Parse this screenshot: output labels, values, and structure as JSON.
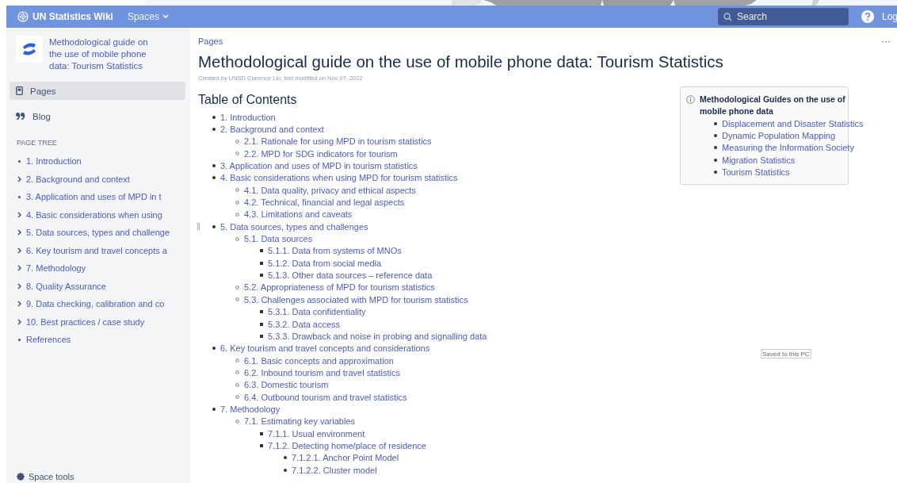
{
  "header": {
    "site_name": "UN Statistics Wiki",
    "spaces_menu": "Spaces",
    "search": {
      "placeholder": "Search"
    },
    "login": "Log"
  },
  "sidebar": {
    "space_title": "Methodological guide on the use of mobile phone data: Tourism Statistics",
    "nav": [
      {
        "kind": "pages",
        "label": "Pages",
        "selected": true
      },
      {
        "kind": "blog",
        "label": "Blog",
        "selected": false
      }
    ],
    "tree_heading": "PAGE TREE",
    "tree": [
      {
        "label": "1. Introduction",
        "kind": "leaf"
      },
      {
        "label": "2. Background and context",
        "kind": "branch"
      },
      {
        "label": "3. Application and uses of MPD in t",
        "kind": "leaf"
      },
      {
        "label": "4. Basic considerations when using",
        "kind": "branch"
      },
      {
        "label": "5. Data sources, types and challenge",
        "kind": "branch"
      },
      {
        "label": "6. Key tourism and travel concepts a",
        "kind": "branch"
      },
      {
        "label": "7. Methodology",
        "kind": "branch"
      },
      {
        "label": "8. Quality Assurance",
        "kind": "branch"
      },
      {
        "label": "9. Data checking, calibration and co",
        "kind": "branch"
      },
      {
        "label": "10. Best practices / case study",
        "kind": "branch"
      },
      {
        "label": "References",
        "kind": "leaf"
      }
    ],
    "footer": "Space tools"
  },
  "page": {
    "breadcrumb": "Pages",
    "more": "···",
    "title": "Methodological guide on the use of mobile phone data: Tourism Statistics",
    "meta": "Created by UNSD Clarence Lio, last modified on Nov 07, 2022",
    "toc": {
      "heading": "Table of Contents",
      "items": [
        {
          "label": "1. Introduction"
        },
        {
          "label": "2. Background and context",
          "children": [
            {
              "label": "2.1. Rationale for using MPD in tourism statistics"
            },
            {
              "label": "2.2. MPD for SDG indicators for tourism"
            }
          ]
        },
        {
          "label": "3. Application and uses of MPD in tourism statistics"
        },
        {
          "label": "4. Basic considerations when using MPD for tourism statistics",
          "children": [
            {
              "label": "4.1. Data quality, privacy and ethical aspects"
            },
            {
              "label": "4.2. Technical, financial and legal aspects"
            },
            {
              "label": "4.3. Limitations and caveats"
            }
          ]
        },
        {
          "label": "5. Data sources, types and challenges",
          "children": [
            {
              "label": "5.1. Data sources",
              "children": [
                {
                  "label": "5.1.1. Data from systems of MNOs"
                },
                {
                  "label": "5.1.2. Data from social media"
                },
                {
                  "label": "5.1.3. Other data sources – reference data"
                }
              ]
            },
            {
              "label": "5.2. Appropriateness of MPD for tourism statistics"
            },
            {
              "label": "5.3. Challenges associated with MPD for tourism statistics",
              "children": [
                {
                  "label": "5.3.1. Data confidentiality"
                },
                {
                  "label": "5.3.2. Data access"
                },
                {
                  "label": "5.3.3. Drawback and noise in probing and signalling data"
                }
              ]
            }
          ]
        },
        {
          "label": "6. Key tourism and travel concepts and considerations",
          "children": [
            {
              "label": "6.1. Basic concepts and approximation"
            },
            {
              "label": "6.2. Inbound tourism and travel statistics"
            },
            {
              "label": "6.3. Domestic tourism"
            },
            {
              "label": "6.4. Outbound tourism and travel statistics"
            }
          ]
        },
        {
          "label": "7. Methodology",
          "children": [
            {
              "label": "7.1. Estimating key variables",
              "children": [
                {
                  "label": "7.1.1. Usual environment"
                },
                {
                  "label": "7.1.2. Detecting home/place of residence",
                  "children": [
                    {
                      "label": "7.1.2.1. Anchor Point Model"
                    },
                    {
                      "label": "7.1.2.2. Cluster model"
                    }
                  ]
                }
              ]
            }
          ]
        }
      ]
    },
    "info_panel": {
      "title": "Methodological Guides on the use of mobile phone data",
      "links": [
        "Displacement and Disaster Statistics",
        "Dynamic Population Mapping",
        "Measuring the Information Society",
        "Migration Statistics",
        "Tourism Statistics"
      ]
    },
    "saved_badge": "Saved to this PC"
  }
}
